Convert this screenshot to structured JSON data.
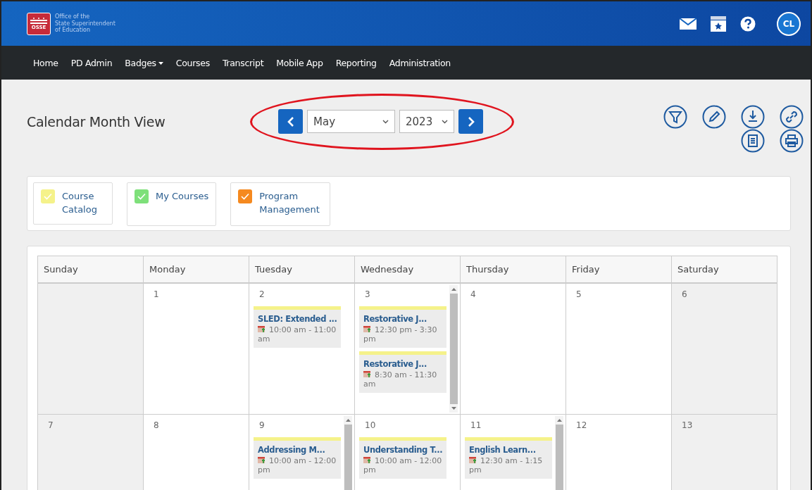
{
  "logo": {
    "mark": "OSSE",
    "lines": [
      "Office of the",
      "State Superintendent",
      "of Education"
    ]
  },
  "header": {
    "avatar": "CL"
  },
  "nav": [
    {
      "label": "Home",
      "dropdown": false
    },
    {
      "label": "PD Admin",
      "dropdown": false
    },
    {
      "label": "Badges",
      "dropdown": true
    },
    {
      "label": "Courses",
      "dropdown": false
    },
    {
      "label": "Transcript",
      "dropdown": false
    },
    {
      "label": "Mobile App",
      "dropdown": false
    },
    {
      "label": "Reporting",
      "dropdown": false
    },
    {
      "label": "Administration",
      "dropdown": false
    }
  ],
  "page": {
    "title": "Calendar Month View",
    "month": "May",
    "year": "2023",
    "highlighted": true
  },
  "legend": [
    {
      "label": "Course Catalog",
      "checked": true,
      "color": "#f5f28a"
    },
    {
      "label": "My Courses",
      "checked": true,
      "color": "#7ee07a"
    },
    {
      "label": "Program Management",
      "checked": true,
      "color": "#f5891f"
    }
  ],
  "calendar": {
    "weekdays": [
      "Sunday",
      "Monday",
      "Tuesday",
      "Wednesday",
      "Thursday",
      "Friday",
      "Saturday"
    ],
    "weeks": [
      {
        "days": [
          {
            "scroll": false
          },
          {
            "date": "1",
            "scroll": false
          },
          {
            "date": "2",
            "scroll": false,
            "events": [
              {
                "title": "SLED: Extended ...",
                "time": "10:00 am - 11:00 am",
                "color": "#f5f28a"
              }
            ]
          },
          {
            "date": "3",
            "scroll": true,
            "events": [
              {
                "title": "Restorative J...",
                "time": "12:30 pm - 3:30 pm",
                "color": "#f5f28a"
              },
              {
                "title": "Restorative J...",
                "time": "8:30 am - 11:30 am",
                "color": "#f5f28a"
              }
            ]
          },
          {
            "date": "4",
            "scroll": false
          },
          {
            "date": "5",
            "scroll": false
          },
          {
            "date": "6",
            "scroll": false
          }
        ]
      },
      {
        "days": [
          {
            "date": "7",
            "scroll": false
          },
          {
            "date": "8",
            "scroll": false
          },
          {
            "date": "9",
            "scroll": true,
            "events": [
              {
                "title": "Addressing M...",
                "time": "10:00 am - 12:00 pm",
                "color": "#f5f28a"
              }
            ]
          },
          {
            "date": "10",
            "scroll": false,
            "events": [
              {
                "title": "Understanding T...",
                "time": "10:00 am - 12:00 pm",
                "color": "#f5f28a"
              }
            ]
          },
          {
            "date": "11",
            "scroll": true,
            "events": [
              {
                "title": "English Learn...",
                "time": "12:30 am - 1:15 pm",
                "color": "#f5f28a"
              }
            ]
          },
          {
            "date": "12",
            "scroll": false
          },
          {
            "date": "13",
            "scroll": false
          }
        ]
      }
    ]
  }
}
